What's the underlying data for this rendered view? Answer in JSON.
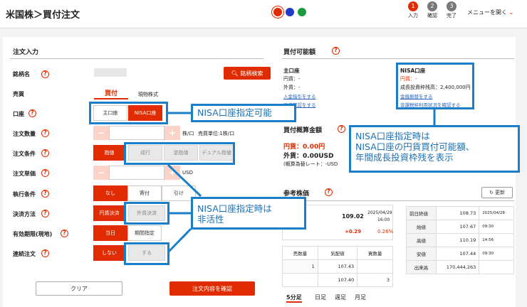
{
  "header": {
    "title": "米国株＞買付注文",
    "steps": [
      {
        "num": "1",
        "label": "入力"
      },
      {
        "num": "2",
        "label": "確認"
      },
      {
        "num": "3",
        "label": "完了"
      }
    ],
    "menu": "メニューを開く",
    "dot_colors": [
      "#e02c00",
      "#1f3ac8",
      "#1a9a3a"
    ]
  },
  "order": {
    "section": "注文入力",
    "labels": {
      "ticker": "銘柄名",
      "side": "売買",
      "account": "口座",
      "qty": "注文数量",
      "cond": "注文条件",
      "price": "注文単価",
      "exec": "執行条件",
      "settle": "決済方法",
      "expiry": "有効期限(現地)",
      "cont": "連続注文"
    },
    "ticker_search": "銘柄検索",
    "side": {
      "buy": "買付",
      "type": "現物株式"
    },
    "account": [
      "主口座",
      "NISA口座"
    ],
    "qty": {
      "unit": "株/口",
      "min_unit": "売買単位:1株/口"
    },
    "cond": [
      "指値",
      "成行",
      "逆指値",
      "デュアル指値"
    ],
    "price": {
      "unit": "USD"
    },
    "exec": [
      "なし",
      "寄付",
      "引け"
    ],
    "settle": [
      "円貨決済",
      "外貨決済"
    ],
    "expiry": [
      "当日",
      "期間指定"
    ],
    "cont": [
      "しない",
      "する"
    ],
    "clear": "クリア",
    "confirm": "注文内容を確認"
  },
  "buying": {
    "section": "買付可能額",
    "main": {
      "title": "主口座",
      "jpy": "円貨：-",
      "fx": "外貨：-",
      "link1": "入金指引をする",
      "link2": "口座確認をする"
    },
    "nisa": {
      "title": "NISA口座",
      "jpy": "円貨：-",
      "limit": "成長投資枠残高：2,400,000円",
      "link1": "金銭振替をする",
      "link2": "非課税枠利用状況を確認する"
    }
  },
  "estimate": {
    "section": "買付概算金額",
    "jpy": "円貨：0.00円",
    "fx": "外貨：0.00USD",
    "note": "(概算為替レート：-USD"
  },
  "ref": {
    "section": "参考株価",
    "refresh": "更新",
    "price": "109.02",
    "date": "2025/04/29",
    "time": "16:00",
    "change": "+0.29",
    "pct": "0.26%",
    "board_headers": [
      "売数量",
      "気配値",
      "買数量"
    ],
    "board": [
      [
        "1",
        "107.43",
        ""
      ],
      [
        "",
        "107.40",
        "3"
      ]
    ],
    "stats": [
      [
        "前日終値",
        "108.73",
        "2025/04/28"
      ],
      [
        "始値",
        "107.67",
        "09:30"
      ],
      [
        "高値",
        "110.19",
        "14:56"
      ],
      [
        "安値",
        "107.44",
        "09:30"
      ],
      [
        "出来高",
        "170,444,263",
        ""
      ]
    ],
    "tabs": [
      "5分足",
      "日足",
      "週足",
      "月足"
    ]
  },
  "callouts": {
    "a": "NISA口座指定可能",
    "b": "NISA口座指定時は\nNISA口座の円貨買付可能額、\n年間成長投資枠残を表示",
    "c": "NISA口座指定時は\n非活性"
  }
}
